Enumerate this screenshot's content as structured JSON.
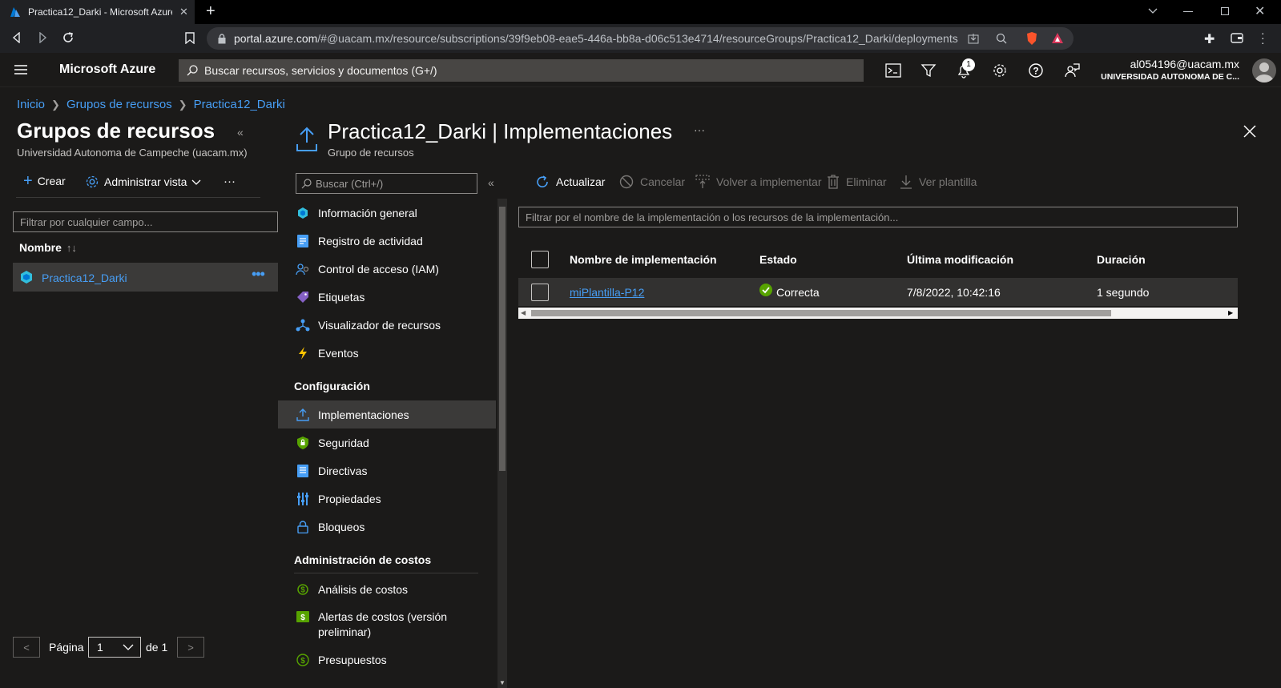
{
  "browser": {
    "tab_title": "Practica12_Darki - Microsoft Azure",
    "url_domain": "portal.azure.com",
    "url_path": "/#@uacam.mx/resource/subscriptions/39f9eb08-eae5-446a-bb8a-d06c513e4714/resourceGroups/Practica12_Darki/deployments"
  },
  "topbar": {
    "brand": "Microsoft Azure",
    "search_placeholder": "Buscar recursos, servicios y documentos (G+/)",
    "notifications_count": "1",
    "account_email": "al054196@uacam.mx",
    "account_org": "UNIVERSIDAD AUTONOMA DE C..."
  },
  "breadcrumb": [
    "Inicio",
    "Grupos de recursos",
    "Practica12_Darki"
  ],
  "left_blade": {
    "title": "Grupos de recursos",
    "subtitle": "Universidad Autonoma de Campeche (uacam.mx)",
    "create_label": "Crear",
    "manage_view_label": "Administrar vista",
    "more_label": "···",
    "filter_placeholder": "Filtrar por cualquier campo...",
    "column_name": "Nombre",
    "items": [
      {
        "name": "Practica12_Darki"
      }
    ],
    "pagination": {
      "label": "Página",
      "current": "1",
      "of": "de 1",
      "prev": "<",
      "next": ">"
    }
  },
  "main_blade": {
    "title": "Practica12_Darki | Implementaciones",
    "subtitle": "Grupo de recursos",
    "menu_search_placeholder": "Buscar (Ctrl+/)",
    "menu": {
      "top_items": [
        {
          "label": "Información general",
          "icon": "resource-group-icon"
        },
        {
          "label": "Registro de actividad",
          "icon": "activity-log-icon"
        },
        {
          "label": "Control de acceso (IAM)",
          "icon": "iam-icon"
        },
        {
          "label": "Etiquetas",
          "icon": "tag-icon"
        },
        {
          "label": "Visualizador de recursos",
          "icon": "resource-visualizer-icon"
        },
        {
          "label": "Eventos",
          "icon": "lightning-icon"
        }
      ],
      "section_config": "Configuración",
      "config_items": [
        {
          "label": "Implementaciones",
          "icon": "deploy-icon",
          "active": true
        },
        {
          "label": "Seguridad",
          "icon": "shield-icon"
        },
        {
          "label": "Directivas",
          "icon": "policy-icon"
        },
        {
          "label": "Propiedades",
          "icon": "properties-icon"
        },
        {
          "label": "Bloqueos",
          "icon": "lock-icon"
        }
      ],
      "section_costs": "Administración de costos",
      "cost_items": [
        {
          "label": "Análisis de costos",
          "icon": "cost-analysis-icon"
        },
        {
          "label": "Alertas de costos (versión preliminar)",
          "icon": "cost-alert-icon"
        },
        {
          "label": "Presupuestos",
          "icon": "budget-icon"
        }
      ]
    },
    "toolbar": {
      "refresh": "Actualizar",
      "cancel": "Cancelar",
      "redeploy": "Volver a implementar",
      "delete": "Eliminar",
      "view_template": "Ver plantilla"
    },
    "filter_placeholder": "Filtrar por el nombre de la implementación o los recursos de la implementación...",
    "table": {
      "headers": [
        "Nombre de implementación",
        "Estado",
        "Última modificación",
        "Duración"
      ],
      "rows": [
        {
          "name": "miPlantilla-P12",
          "status": "Correcta",
          "modified": "7/8/2022, 10:42:16",
          "duration": "1 segundo"
        }
      ]
    }
  }
}
